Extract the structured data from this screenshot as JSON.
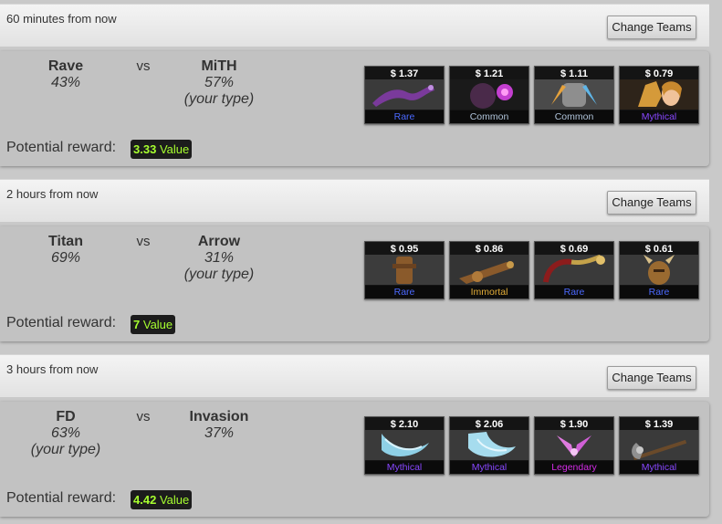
{
  "matches": [
    {
      "time": "60 minutes from now",
      "change_label": "Change Teams",
      "team1": {
        "name": "Rave",
        "pct": "43%",
        "tag": ""
      },
      "vs": "vs",
      "team2": {
        "name": "MiTH",
        "pct": "57%",
        "tag": "(your type)"
      },
      "reward_label": "Potential reward:",
      "reward_value": "3.33",
      "reward_word": "Value",
      "items": [
        {
          "price": "$ 1.37",
          "rarity": "Rare",
          "color": "#4b69ff",
          "icon": "serpent-item-icon"
        },
        {
          "price": "$ 1.21",
          "rarity": "Common",
          "color": "#b0c3d9",
          "icon": "dark-hero-item-icon"
        },
        {
          "price": "$ 1.11",
          "rarity": "Common",
          "color": "#b0c3d9",
          "icon": "winged-armor-item-icon"
        },
        {
          "price": "$ 0.79",
          "rarity": "Mythical",
          "color": "#8847ff",
          "icon": "hero-portrait-item-icon"
        }
      ]
    },
    {
      "time": "2 hours from now",
      "change_label": "Change Teams",
      "team1": {
        "name": "Titan",
        "pct": "69%",
        "tag": ""
      },
      "vs": "vs",
      "team2": {
        "name": "Arrow",
        "pct": "31%",
        "tag": "(your type)"
      },
      "reward_label": "Potential reward:",
      "reward_value": "7",
      "reward_word": "Value",
      "items": [
        {
          "price": "$ 0.95",
          "rarity": "Rare",
          "color": "#4b69ff",
          "icon": "wooden-totem-item-icon"
        },
        {
          "price": "$ 0.86",
          "rarity": "Immortal",
          "color": "#e4ae39",
          "icon": "cannon-item-icon"
        },
        {
          "price": "$ 0.69",
          "rarity": "Rare",
          "color": "#4b69ff",
          "icon": "chain-item-icon"
        },
        {
          "price": "$ 0.61",
          "rarity": "Rare",
          "color": "#4b69ff",
          "icon": "horned-helm-item-icon"
        }
      ]
    },
    {
      "time": "3 hours from now",
      "change_label": "Change Teams",
      "team1": {
        "name": "FD",
        "pct": "63%",
        "tag": "(your type)"
      },
      "vs": "vs",
      "team2": {
        "name": "Invasion",
        "pct": "37%",
        "tag": ""
      },
      "reward_label": "Potential reward:",
      "reward_value": "4.42",
      "reward_word": "Value",
      "items": [
        {
          "price": "$ 2.10",
          "rarity": "Mythical",
          "color": "#8847ff",
          "icon": "ice-blade-item-icon"
        },
        {
          "price": "$ 2.06",
          "rarity": "Mythical",
          "color": "#8847ff",
          "icon": "ice-shield-item-icon"
        },
        {
          "price": "$ 1.90",
          "rarity": "Legendary",
          "color": "#d32ce6",
          "icon": "pink-wings-item-icon"
        },
        {
          "price": "$ 1.39",
          "rarity": "Mythical",
          "color": "#8847ff",
          "icon": "axe-item-icon"
        }
      ]
    }
  ]
}
